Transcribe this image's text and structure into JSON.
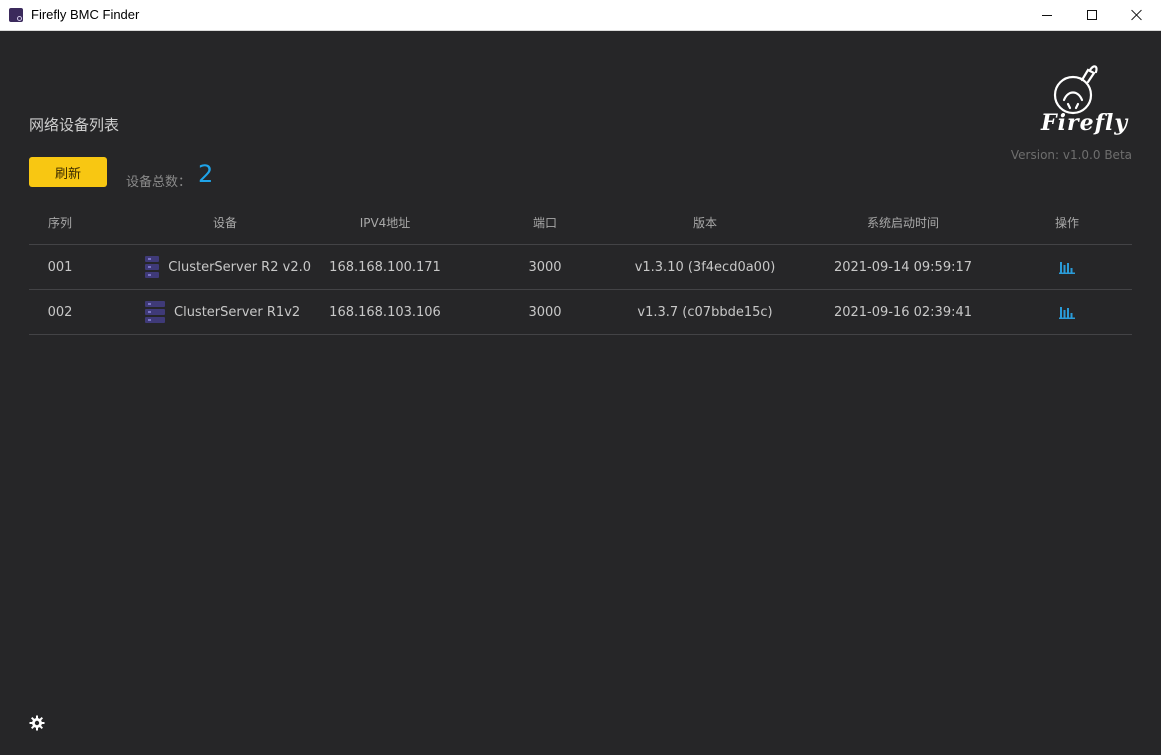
{
  "window": {
    "title": "Firefly BMC Finder"
  },
  "brand": {
    "logo_text": "Firefly",
    "version": "Version: v1.0.0 Beta"
  },
  "main": {
    "section_title": "网络设备列表",
    "refresh_label": "刷新",
    "count_label": "设备总数：",
    "count_value": "2"
  },
  "table": {
    "headers": {
      "index": "序列",
      "device": "设备",
      "ipv4": "IPV4地址",
      "port": "端口",
      "version": "版本",
      "boot_time": "系统启动时间",
      "action": "操作"
    },
    "rows": [
      {
        "index": "001",
        "device": "ClusterServer R2 v2.0",
        "ipv4": "168.168.100.171",
        "port": "3000",
        "version": "v1.3.10 (3f4ecd0a00)",
        "boot_time": "2021-09-14 09:59:17",
        "action_icon": "bar-chart-icon"
      },
      {
        "index": "002",
        "device": "ClusterServer R1v2",
        "ipv4": "168.168.103.106",
        "port": "3000",
        "version": "v1.3.7 (c07bbde15c)",
        "boot_time": "2021-09-16 02:39:41",
        "action_icon": "bar-chart-icon"
      }
    ]
  },
  "footer": {
    "settings_icon": "gear-icon"
  },
  "colors": {
    "background": "#262628",
    "accent_button": "#f8c712",
    "count_value": "#1fa3e8",
    "action_icon": "#2a9bd8"
  }
}
